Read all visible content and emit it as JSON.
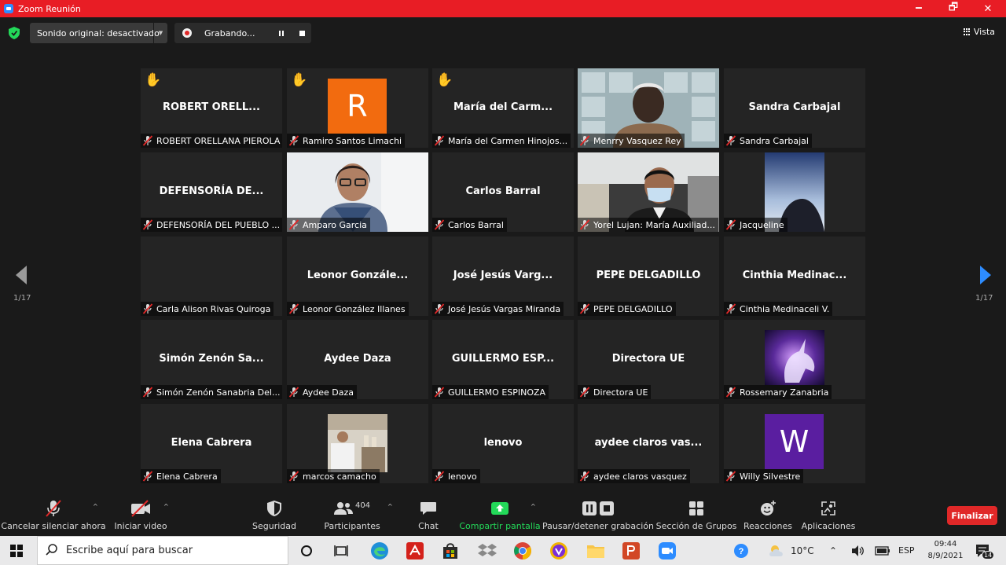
{
  "window": {
    "title": "Zoom Reunión",
    "minimize": "🗕",
    "maximize": "🗗",
    "close": "✕"
  },
  "topbar": {
    "sound_label": "Sonido original: desactivado",
    "recording_label": "Grabando...",
    "view_label": "Vista"
  },
  "pagination": {
    "left": "1/17",
    "right": "1/17"
  },
  "participants": [
    {
      "big": "ROBERT ORELL...",
      "label": "ROBERT ORELLANA PIEROLA",
      "hand": true
    },
    {
      "big": "",
      "label": "Ramiro Santos Limachi",
      "hand": true,
      "avatar_letter": "R",
      "avatar_color": "#f26b0f"
    },
    {
      "big": "María del Carm...",
      "label": "María del Carmen Hinojos...",
      "hand": true
    },
    {
      "big": "",
      "label": "Menrry Vasquez Rey",
      "active": true,
      "photo": "video-woman"
    },
    {
      "big": "Sandra Carbajal",
      "label": "Sandra Carbajal"
    },
    {
      "big": "DEFENSORÍA DE...",
      "label": "DEFENSORÍA DEL PUEBLO ..."
    },
    {
      "big": "",
      "label": "Amparo Garcia",
      "photo": "video-amparo"
    },
    {
      "big": "Carlos Barral",
      "label": "Carlos Barral"
    },
    {
      "big": "",
      "label": "Yorel Lujan: María Auxiliad...",
      "photo": "video-man-mask"
    },
    {
      "big": "",
      "label": "Jacqueline",
      "photo": "picture-sky"
    },
    {
      "big": "",
      "label": "Carla Alison Rivas Quiroga"
    },
    {
      "big": "Leonor Gonzále...",
      "label": "Leonor González Illanes"
    },
    {
      "big": "José Jesús Varg...",
      "label": "José Jesús Vargas Miranda"
    },
    {
      "big": "PEPE DELGADILLO",
      "label": "PEPE DELGADILLO"
    },
    {
      "big": "Cinthia Medinac...",
      "label": "Cinthia Medinaceli V."
    },
    {
      "big": "Simón Zenón Sa...",
      "label": "Simón Zenón Sanabria Del..."
    },
    {
      "big": "Aydee Daza",
      "label": "Aydee Daza"
    },
    {
      "big": "GUILLERMO ESP...",
      "label": "GUILLERMO ESPINOZA"
    },
    {
      "big": "Directora UE",
      "label": "Directora UE"
    },
    {
      "big": "",
      "label": "Rossemary Zanabria",
      "photo": "picture-unicorn"
    },
    {
      "big": "Elena Cabrera",
      "label": "Elena Cabrera"
    },
    {
      "big": "",
      "label": "marcos camacho",
      "photo": "picture-lab"
    },
    {
      "big": "lenovo",
      "label": "lenovo"
    },
    {
      "big": "aydee claros vas...",
      "label": "aydee claros vasquez"
    },
    {
      "big": "",
      "label": "Willy Silvestre",
      "avatar_letter": "W",
      "avatar_color": "#5a1ea0"
    }
  ],
  "toolbar": {
    "unmute": "Cancelar silenciar ahora",
    "video": "Iniciar video",
    "security": "Seguridad",
    "participants": "Participantes",
    "participants_count": "404",
    "chat": "Chat",
    "share": "Compartir pantalla",
    "pause_rec": "Pausar/detener grabación",
    "breakout": "Sección de Grupos",
    "reactions": "Reacciones",
    "apps": "Aplicaciones",
    "end": "Finalizar",
    "accent_share": "#23d959"
  },
  "taskbar": {
    "search_placeholder": "Escribe aquí para buscar",
    "temperature": "10°C",
    "language": "ESP",
    "time": "09:44",
    "date": "8/9/2021",
    "notifications": "14"
  }
}
